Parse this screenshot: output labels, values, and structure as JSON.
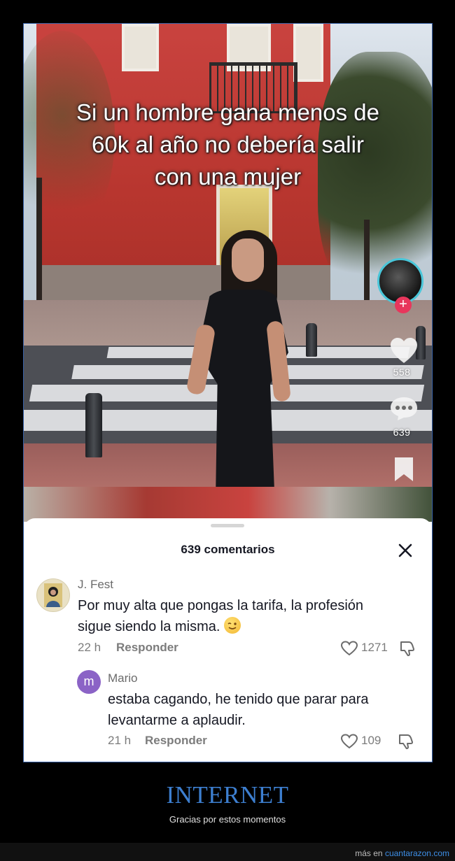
{
  "video": {
    "caption_lines": [
      "Si un hombre gana menos de",
      "60k al año no debería salir",
      "con una mujer"
    ],
    "likes": "558",
    "comments": "639",
    "icons": [
      "plus-icon",
      "heart-icon",
      "comment-bubble-icon",
      "bookmark-icon"
    ]
  },
  "comments_sheet": {
    "title": "639 comentarios",
    "close_icon": "close-icon",
    "comments": [
      {
        "author": "J. Fest",
        "text_lines": [
          "Por muy alta que pongas la tarifa, la profesión",
          "sigue siendo la misma."
        ],
        "emoji": "winking-face-emoji",
        "time": "22 h",
        "reply_label": "Responder",
        "likes": "1271"
      },
      {
        "author": "Mario",
        "avatar_letter": "m",
        "text_lines": [
          "estaba cagando, he tenido que parar para",
          "levantarme a aplaudir."
        ],
        "time": "21 h",
        "reply_label": "Responder",
        "likes": "109"
      }
    ]
  },
  "footer": {
    "category": "INTERNET",
    "subtitle": "Gracias por estos momentos",
    "credit_prefix": "más en",
    "credit_link": "cuantarazon.com"
  },
  "colors": {
    "accent_blue": "#3d7fd0",
    "follow_pink": "#e8365c",
    "mario_avatar": "#8b63c6"
  }
}
